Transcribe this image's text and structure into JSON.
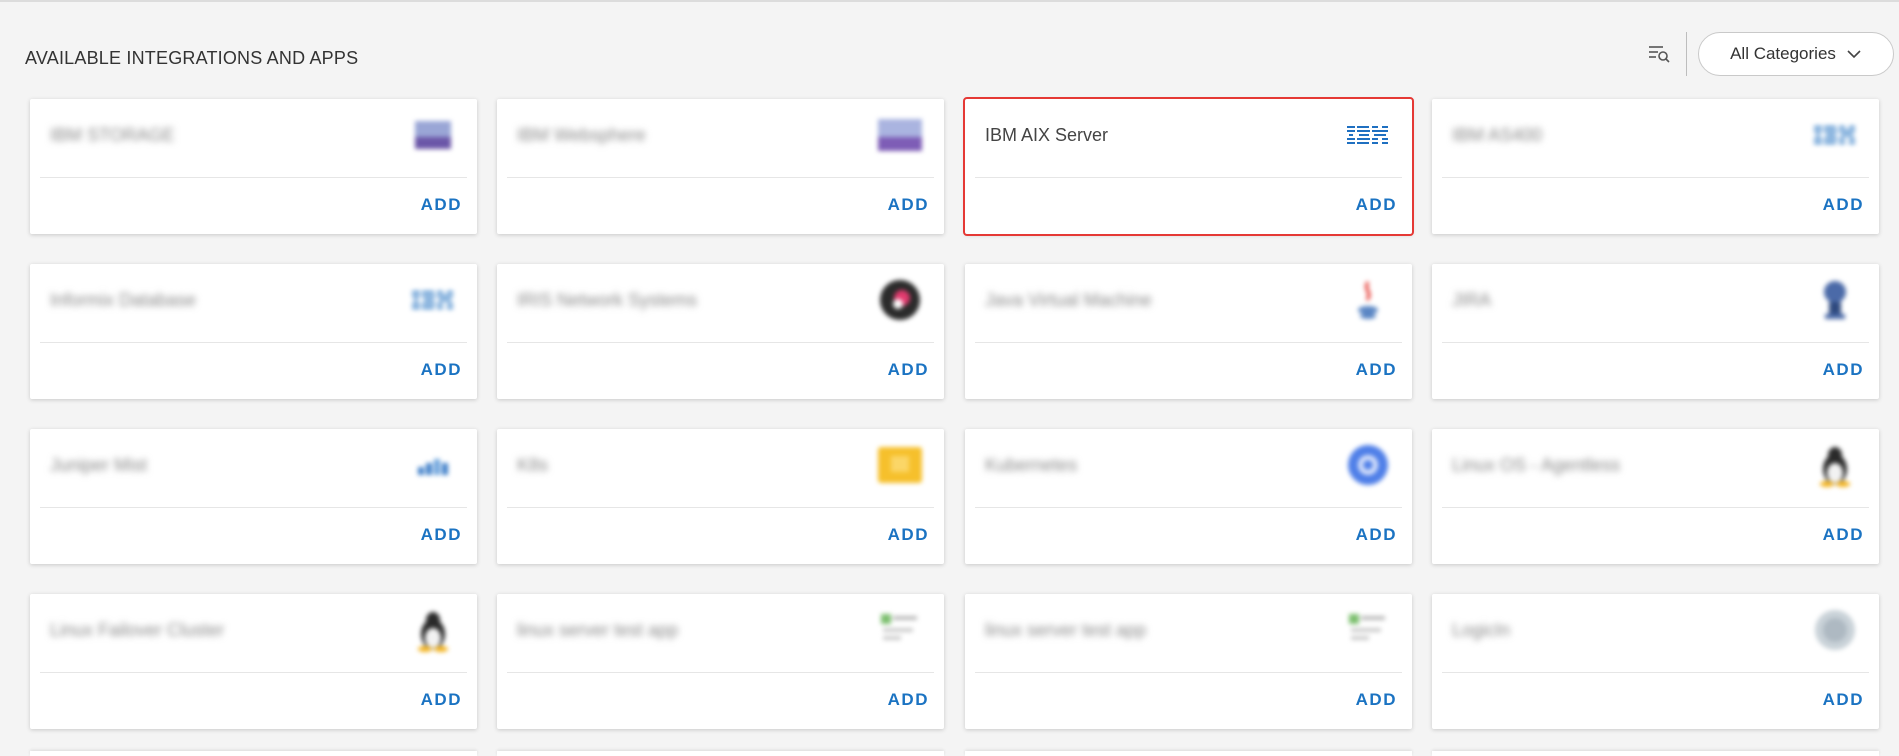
{
  "header": {
    "title": "AVAILABLE INTEGRATIONS AND APPS",
    "category_select": "All Categories"
  },
  "add_label": "ADD",
  "accent_color": "#1b73c2",
  "highlight_color": "#e53935",
  "cards": [
    {
      "name": "IBM STORAGE",
      "icon": "storage-icon",
      "blurred": true
    },
    {
      "name": "IBM Websphere",
      "icon": "websphere-icon",
      "blurred": true
    },
    {
      "name": "IBM AIX Server",
      "icon": "ibm-logo-icon",
      "blurred": false,
      "selected": true
    },
    {
      "name": "IBM AS400",
      "icon": "ibm-logo-icon",
      "blurred": true
    },
    {
      "name": "Informix Database",
      "icon": "ibm-logo-icon",
      "blurred": true
    },
    {
      "name": "IRIS Network Systems",
      "icon": "iris-icon",
      "blurred": true
    },
    {
      "name": "Java Virtual Machine",
      "icon": "java-icon",
      "blurred": true
    },
    {
      "name": "JIRA",
      "icon": "jira-icon",
      "blurred": true
    },
    {
      "name": "Juniper Mist",
      "icon": "juniper-icon",
      "blurred": true
    },
    {
      "name": "K8s",
      "icon": "k8s-icon",
      "blurred": true
    },
    {
      "name": "Kubernetes",
      "icon": "kubernetes-icon",
      "blurred": true
    },
    {
      "name": "Linux OS - Agentless",
      "icon": "linux-icon",
      "blurred": true
    },
    {
      "name": "Linux Failover Cluster",
      "icon": "linux-icon",
      "blurred": true
    },
    {
      "name": "linux server test app",
      "icon": "broken-image-icon",
      "blurred": true
    },
    {
      "name": "linux server test app",
      "icon": "broken-image-icon",
      "blurred": true
    },
    {
      "name": "LogicIn",
      "icon": "logicin-icon",
      "blurred": true
    }
  ]
}
